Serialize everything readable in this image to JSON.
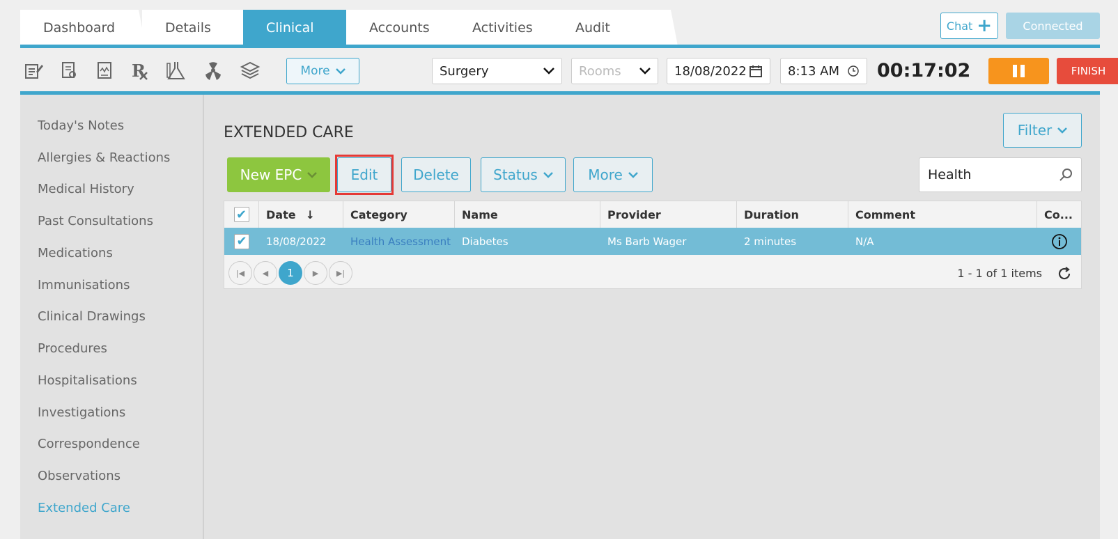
{
  "tabs": [
    "Dashboard",
    "Details",
    "Clinical",
    "Accounts",
    "Activities",
    "Audit"
  ],
  "active_tab": "Clinical",
  "top_buttons": {
    "chat": "Chat",
    "connected": "Connected"
  },
  "toolbar": {
    "icons": [
      "notes-icon",
      "certificate-icon",
      "report-icon",
      "prescription-icon",
      "lab-icon",
      "radiation-icon",
      "education-icon"
    ],
    "more": "More",
    "surgery": "Surgery",
    "rooms_placeholder": "Rooms",
    "date": "18/08/2022",
    "time": "8:13 AM",
    "timer": "00:17:02",
    "finish": "FINISH"
  },
  "sidebar": {
    "items": [
      "Today's Notes",
      "Allergies & Reactions",
      "Medical History",
      "Past Consultations",
      "Medications",
      "Immunisations",
      "Clinical Drawings",
      "Procedures",
      "Hospitalisations",
      "Investigations",
      "Correspondence",
      "Observations",
      "Extended Care"
    ],
    "active": "Extended Care"
  },
  "main": {
    "title": "EXTENDED CARE",
    "filter": "Filter",
    "actions": {
      "new_epc": "New EPC",
      "edit": "Edit",
      "delete": "Delete",
      "status": "Status",
      "more": "More"
    },
    "search_value": "Health",
    "columns": [
      "Date",
      "Category",
      "Name",
      "Provider",
      "Duration",
      "Comment",
      "Co..."
    ],
    "rows": [
      {
        "date": "18/08/2022",
        "category": "Health Assessment",
        "name": "Diabetes",
        "provider": "Ms Barb Wager",
        "duration": "2 minutes",
        "comment": "N/A"
      }
    ],
    "pager": {
      "page": "1",
      "info": "1 - 1 of 1 items"
    }
  },
  "colors": {
    "accent": "#3fa6cc",
    "green": "#8dc63f",
    "orange": "#f7941d",
    "red": "#e74c3c",
    "highlight": "#e53935"
  }
}
